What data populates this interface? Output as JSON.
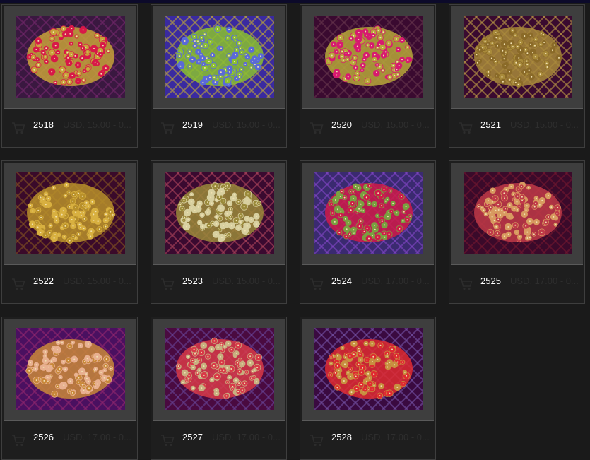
{
  "products": [
    {
      "id": "2518",
      "price": "USD. 15.00 - 0...",
      "palette": [
        "#3a1840",
        "#c8a23a",
        "#d81848",
        "#7a2a70"
      ]
    },
    {
      "id": "2519",
      "price": "USD. 15.00 - 0...",
      "palette": [
        "#3a2aa0",
        "#8ac030",
        "#5a6ad8",
        "#c8b030"
      ]
    },
    {
      "id": "2520",
      "price": "USD. 15.00 - 0...",
      "palette": [
        "#3a0a30",
        "#b8a83a",
        "#d81a70",
        "#6a3a50"
      ]
    },
    {
      "id": "2521",
      "price": "USD. 15.00 - 0...",
      "palette": [
        "#3a0a30",
        "#a88a3a",
        "#8a6a28",
        "#c8a848"
      ]
    },
    {
      "id": "2522",
      "price": "USD. 15.00 - 0...",
      "palette": [
        "#3a0a2a",
        "#b8902a",
        "#d8b040",
        "#8a5a20"
      ]
    },
    {
      "id": "2523",
      "price": "USD. 15.00 - 0...",
      "palette": [
        "#3a0a30",
        "#9a8a3a",
        "#d8d0a0",
        "#b84a60"
      ]
    },
    {
      "id": "2524",
      "price": "USD. 17.00 - 0...",
      "palette": [
        "#3a2a70",
        "#d01a48",
        "#7aa040",
        "#8a4ad0"
      ]
    },
    {
      "id": "2525",
      "price": "USD. 17.00 - 0...",
      "palette": [
        "#3a0a2a",
        "#c03a48",
        "#d89a60",
        "#7a1a30"
      ]
    },
    {
      "id": "2526",
      "price": "USD. 17.00 - 0...",
      "palette": [
        "#4a1060",
        "#c8883a",
        "#e8b090",
        "#9a2a70"
      ]
    },
    {
      "id": "2527",
      "price": "USD. 17.00 - 0...",
      "palette": [
        "#4a0a40",
        "#d83a48",
        "#c8b080",
        "#6a4aa0"
      ]
    },
    {
      "id": "2528",
      "price": "USD. 17.00 - 0...",
      "palette": [
        "#3a0a40",
        "#e02a30",
        "#c89040",
        "#7a5ab0"
      ]
    }
  ]
}
